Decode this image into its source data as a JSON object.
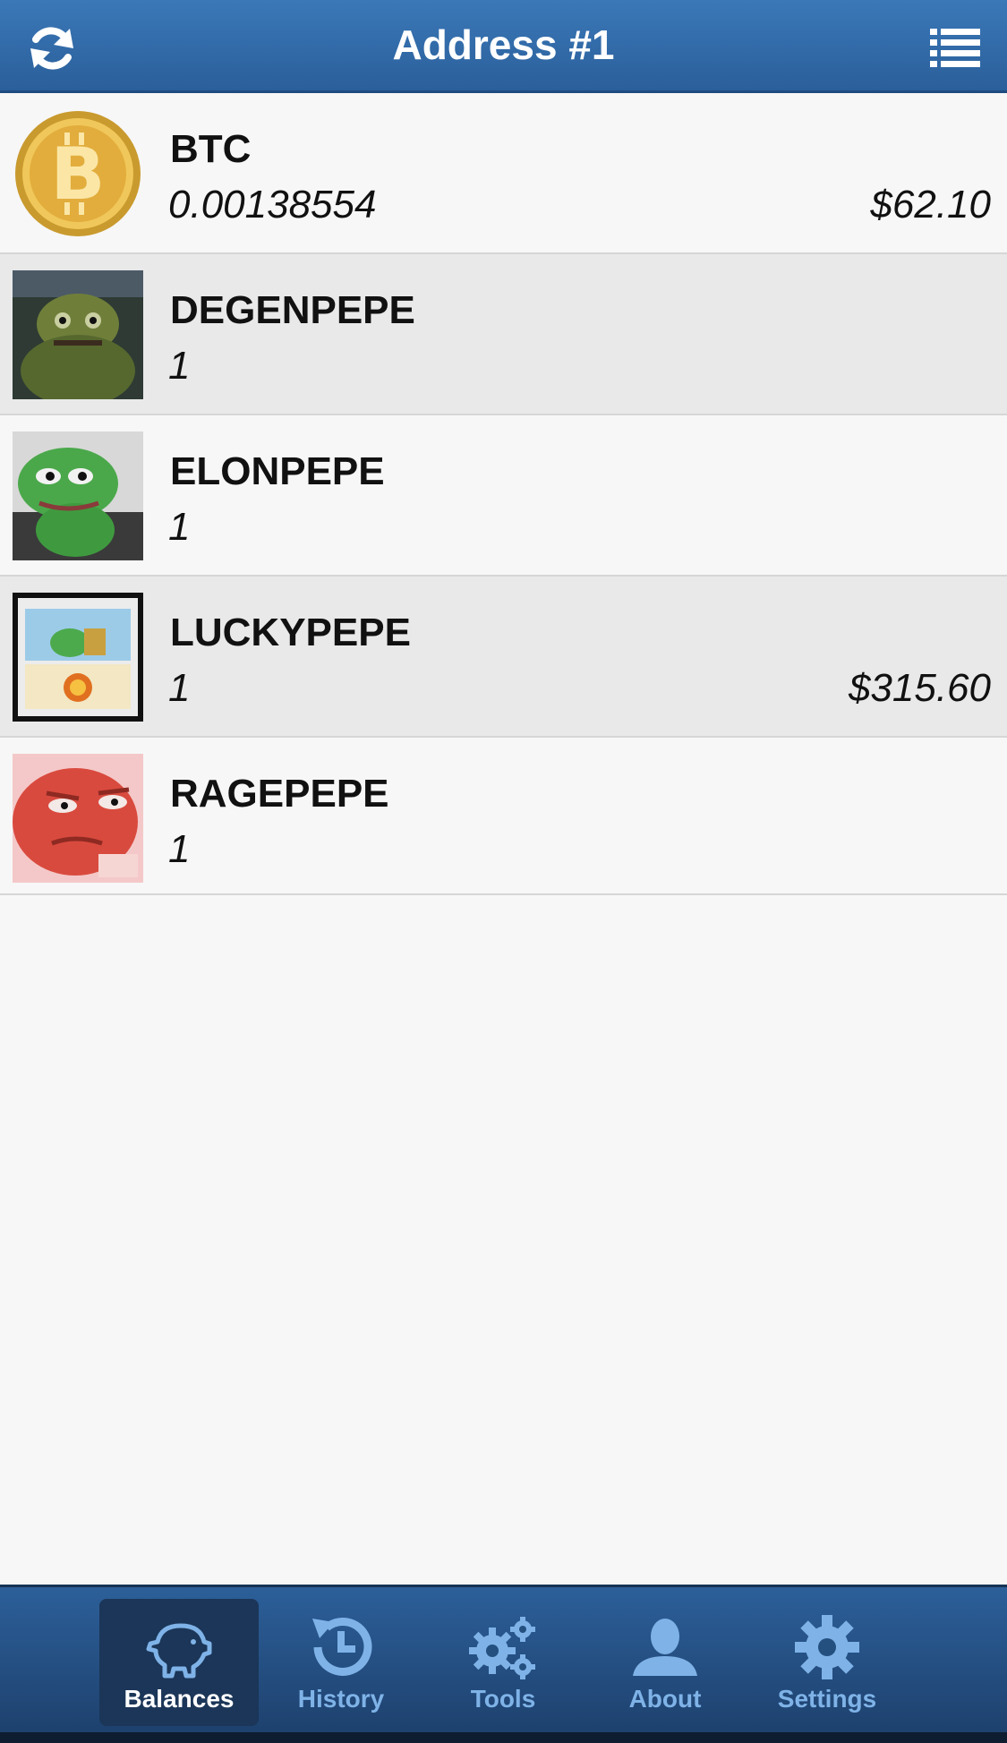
{
  "header": {
    "title": "Address #1",
    "left_icon": "refresh-icon",
    "right_icon": "list-icon"
  },
  "balances": [
    {
      "asset": "BTC",
      "quantity": "0.00138554",
      "usd": "$62.10",
      "icon": "bitcoin-coin"
    },
    {
      "asset": "DEGENPEPE",
      "quantity": "1",
      "usd": "",
      "icon": "degenpepe-card"
    },
    {
      "asset": "ELONPEPE",
      "quantity": "1",
      "usd": "",
      "icon": "elonpepe-card"
    },
    {
      "asset": "LUCKYPEPE",
      "quantity": "1",
      "usd": "$315.60",
      "icon": "luckypepe-card"
    },
    {
      "asset": "RAGEPEPE",
      "quantity": "1",
      "usd": "",
      "icon": "ragepepe-card"
    }
  ],
  "tabs": [
    {
      "label": "Balances",
      "icon": "piggy-bank-icon",
      "active": true
    },
    {
      "label": "History",
      "icon": "history-icon",
      "active": false
    },
    {
      "label": "Tools",
      "icon": "gears-icon",
      "active": false
    },
    {
      "label": "About",
      "icon": "person-icon",
      "active": false
    },
    {
      "label": "Settings",
      "icon": "gear-icon",
      "active": false
    }
  ],
  "colors": {
    "header_blue": "#3b78b8",
    "tab_label_blue": "#7fb3e8",
    "row_alt": "#e9e9e9"
  }
}
